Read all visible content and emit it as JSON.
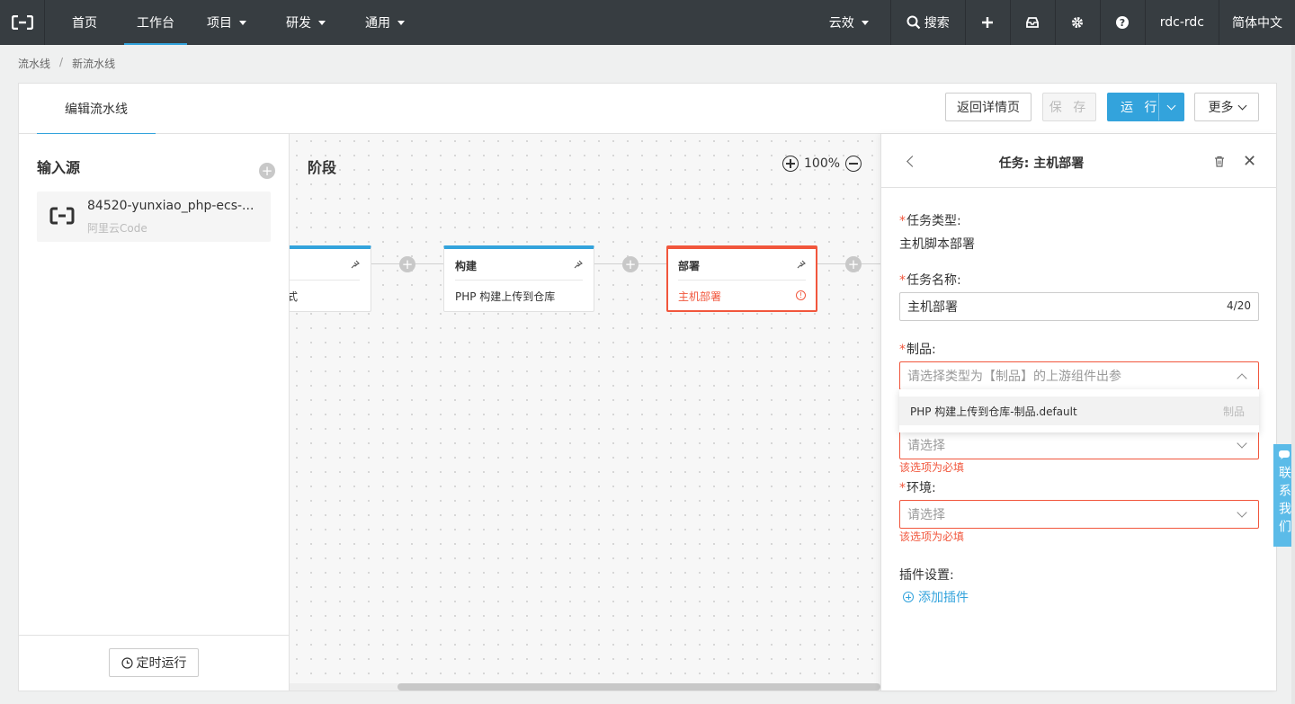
{
  "topnav": {
    "items": [
      {
        "label": "首页"
      },
      {
        "label": "工作台",
        "active": true
      },
      {
        "label": "项目",
        "dropdown": true
      },
      {
        "label": "研发",
        "dropdown": true
      },
      {
        "label": "通用",
        "dropdown": true
      }
    ],
    "product": "云效",
    "search": "搜索",
    "user": "rdc-rdc",
    "language": "简体中文"
  },
  "breadcrumb": [
    "流水线",
    "新流水线"
  ],
  "header": {
    "tab": "编辑流水线",
    "back_label": "返回详情页",
    "save_label": "保 存",
    "run_label": "运 行",
    "more_label": "更多"
  },
  "sources": {
    "title": "输入源",
    "items": [
      {
        "name": "84520-yunxiao_php-ecs-...",
        "type": "阿里云Code"
      }
    ],
    "timer_label": "定时运行"
  },
  "canvas": {
    "title": "阶段",
    "zoom": "100%",
    "jobs": [
      {
        "title": "",
        "task": "式"
      },
      {
        "title": "构建",
        "task": "PHP 构建上传到仓库"
      },
      {
        "title": "部署",
        "task": "主机部署",
        "error": true
      }
    ]
  },
  "panel": {
    "title": "任务: 主机部署",
    "task_type_label": "任务类型:",
    "task_type_value": "主机脚本部署",
    "task_name_label": "任务名称:",
    "task_name_value": "主机部署",
    "task_name_count": "4/20",
    "artifact_label": "制品:",
    "artifact_placeholder": "请选择类型为【制品】的上游组件出参",
    "artifact_option": "PHP 构建上传到仓库-制品.default",
    "artifact_option_tag": "制品",
    "hidden_select_placeholder": "请选择",
    "required_error": "该选项为必填",
    "env_label": "环境:",
    "env_placeholder": "请选择",
    "plugin_label": "插件设置:",
    "add_plugin": "添加插件"
  },
  "contact": "联系我们",
  "colors": {
    "nav_bg": "#373d41",
    "accent": "#33a3dc",
    "error": "#f1563c"
  }
}
